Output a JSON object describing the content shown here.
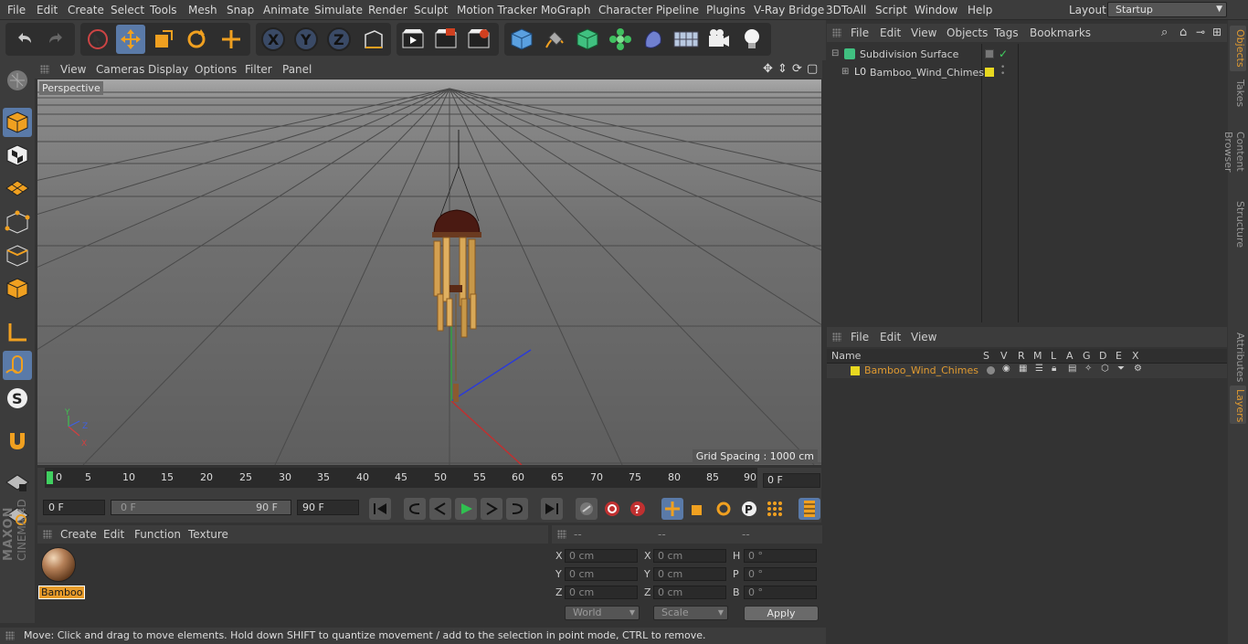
{
  "menubar": {
    "items": [
      "File",
      "Edit",
      "Create",
      "Select",
      "Tools",
      "Mesh",
      "Snap",
      "Animate",
      "Simulate",
      "Render",
      "Sculpt",
      "Motion Tracker",
      "MoGraph",
      "Character",
      "Pipeline",
      "Plugins",
      "V-Ray Bridge",
      "3DToAll",
      "Script",
      "Window",
      "Help"
    ],
    "layout_label": "Layout:",
    "layout_value": "Startup"
  },
  "toolbar": {
    "icons": [
      "undo-icon",
      "redo-icon",
      "live-selection-icon",
      "move-icon",
      "scale-icon",
      "rotate-icon",
      "last-tool-icon",
      "x-axis-icon",
      "y-axis-icon",
      "z-axis-icon",
      "coordinate-system-icon",
      "render-view-icon",
      "render-picture-viewer-icon",
      "render-settings-icon",
      "cube-icon",
      "pen-icon",
      "subdivision-icon",
      "cloner-icon",
      "deformer-icon",
      "floor-icon",
      "camera-icon",
      "light-icon"
    ]
  },
  "lefttools": {
    "icons": [
      "make-editable-icon",
      "model-mode-icon",
      "texture-mode-icon",
      "workplane-mode-icon",
      "points-mode-icon",
      "edges-mode-icon",
      "polygons-mode-icon",
      "enable-axis-icon",
      "tweak-mode-icon",
      "solo-icon",
      "snap-icon",
      "workplane-lock-icon",
      "locked-workplane-icon"
    ],
    "brand_line1": "MAXON",
    "brand_line2": "CINEMA 4D"
  },
  "viewport": {
    "menu": [
      "View",
      "Cameras",
      "Display",
      "Options",
      "Filter",
      "Panel"
    ],
    "label": "Perspective",
    "grid_spacing": "Grid Spacing : 1000 cm",
    "axis": {
      "x": "X",
      "y": "Y",
      "z": "Z"
    }
  },
  "timeline": {
    "ticks": [
      "0",
      "5",
      "10",
      "15",
      "20",
      "25",
      "30",
      "35",
      "40",
      "45",
      "50",
      "55",
      "60",
      "65",
      "70",
      "75",
      "80",
      "85",
      "90"
    ],
    "current_frame": "0 F"
  },
  "transport": {
    "start": "0 F",
    "range_start": "0 F",
    "range_end": "90 F",
    "end": "90 F"
  },
  "materials": {
    "menu": [
      "Create",
      "Edit",
      "Function",
      "Texture"
    ],
    "items": [
      {
        "name": "Bamboo"
      }
    ]
  },
  "coords": {
    "headers": [
      "--",
      "--",
      "--"
    ],
    "rows": [
      {
        "l1": "X",
        "v1": "0 cm",
        "l2": "X",
        "v2": "0 cm",
        "l3": "H",
        "v3": "0 °"
      },
      {
        "l1": "Y",
        "v1": "0 cm",
        "l2": "Y",
        "v2": "0 cm",
        "l3": "P",
        "v3": "0 °"
      },
      {
        "l1": "Z",
        "v1": "0 cm",
        "l2": "Z",
        "v2": "0 cm",
        "l3": "B",
        "v3": "0 °"
      }
    ],
    "mode1": "World",
    "mode2": "Scale",
    "apply": "Apply"
  },
  "status": "Move: Click and drag to move elements. Hold down SHIFT to quantize movement / add to the selection in point mode, CTRL to remove.",
  "objects": {
    "menu": [
      "File",
      "Edit",
      "View",
      "Objects",
      "Tags",
      "Bookmarks"
    ],
    "tree": [
      {
        "name": "Subdivision Surface"
      },
      {
        "name": "Bamboo_Wind_Chimes"
      }
    ],
    "layer_color": "#e8d820"
  },
  "layers": {
    "menu": [
      "File",
      "Edit",
      "View"
    ],
    "columns": [
      "Name",
      "S",
      "V",
      "R",
      "M",
      "L",
      "A",
      "G",
      "D",
      "E",
      "X"
    ],
    "rows": [
      {
        "name": "Bamboo_Wind_Chimes"
      }
    ]
  },
  "right_tabs": [
    "Objects",
    "Takes",
    "Content Browser",
    "Structure",
    "Attributes",
    "Layers"
  ],
  "accent": "#e09a30"
}
